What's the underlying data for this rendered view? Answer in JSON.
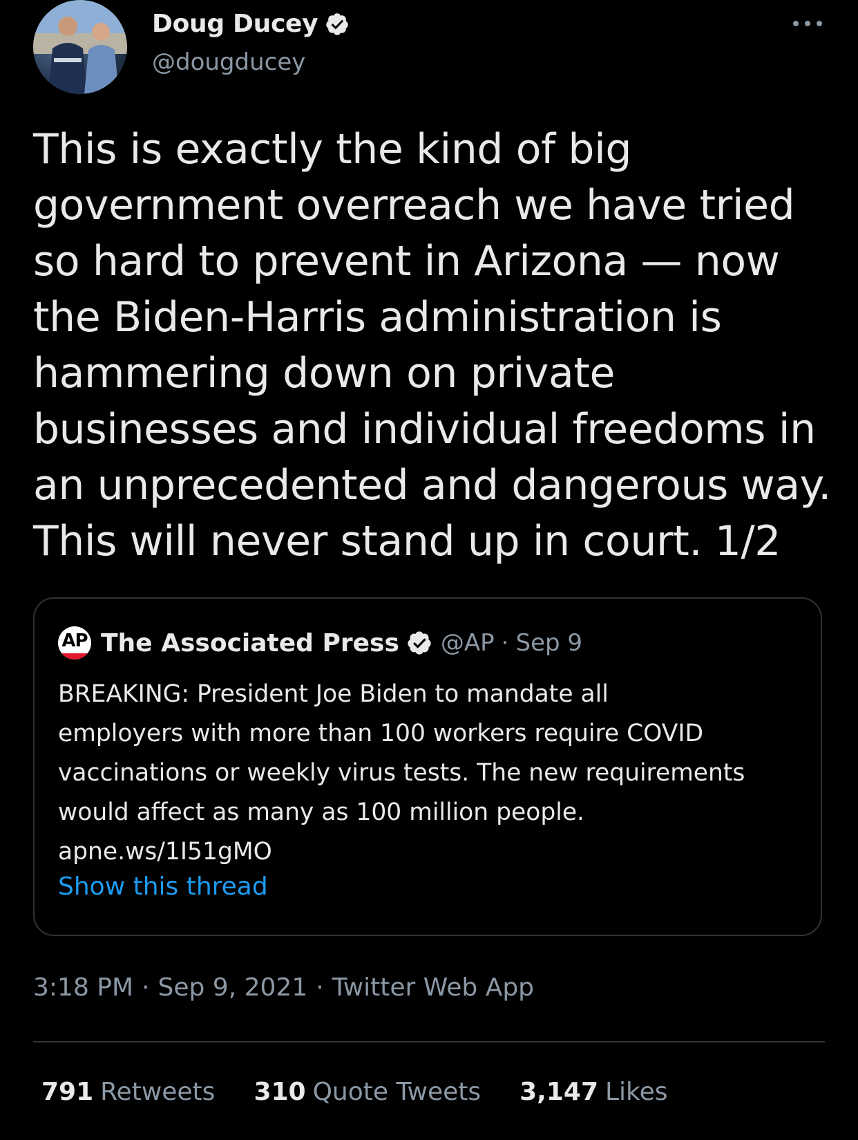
{
  "author": {
    "display_name": "Doug Ducey",
    "handle": "@dougducey",
    "avatar_icon": "profile-photo"
  },
  "tweet": {
    "text": "This is exactly the kind of big\ngovernment overreach we have tried\nso hard to prevent in Arizona — now\nthe Biden-Harris administration is\nhammering down on private\nbusinesses and individual freedoms in\nan unprecedented and dangerous way.\nThis will never stand up in court. 1/2"
  },
  "quoted_tweet": {
    "logo_text": "AP",
    "display_name": "The Associated Press",
    "handle": "@AP",
    "separator": "·",
    "date": "Sep 9",
    "text": "BREAKING: President Joe Biden to mandate all\nemployers with more than 100 workers require COVID\nvaccinations or weekly virus tests. The new requirements\nwould affect as many as 100 million people.\napne.ws/1I51gMO",
    "show_thread": "Show this thread"
  },
  "meta": {
    "time": "3:18 PM",
    "date": "Sep 9, 2021",
    "client": "Twitter Web App",
    "separator": "·"
  },
  "stats": [
    {
      "count": "791",
      "label": "Retweets"
    },
    {
      "count": "310",
      "label": "Quote Tweets"
    },
    {
      "count": "3,147",
      "label": "Likes"
    }
  ],
  "colors": {
    "background": "#000000",
    "text": "#e7e9ea",
    "secondary": "#8b98a5",
    "link": "#1d9bf0",
    "border": "#2f3336"
  }
}
